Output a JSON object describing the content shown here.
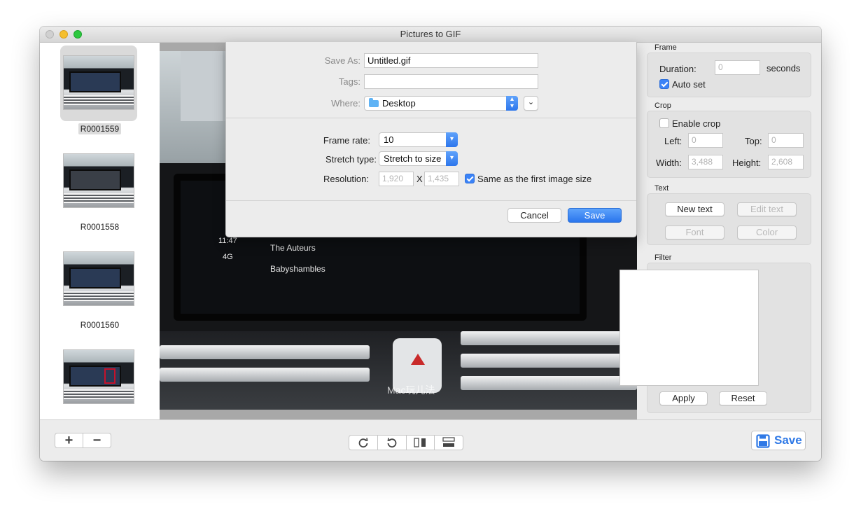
{
  "window": {
    "title": "Pictures to GIF"
  },
  "sidebar": {
    "items": [
      {
        "label": "R0001559",
        "selected": true
      },
      {
        "label": "R0001558",
        "selected": false
      },
      {
        "label": "R0001560",
        "selected": false
      },
      {
        "label": "",
        "selected": false
      }
    ]
  },
  "preview": {
    "songs": [
      "The Auteurs",
      "Babyshambles"
    ],
    "clock": "11:47",
    "network": "4G",
    "watermark": "Mac玩儿法"
  },
  "dialog": {
    "save_as_label": "Save As:",
    "save_as_value": "Untitled.gif",
    "tags_label": "Tags:",
    "tags_value": "",
    "where_label": "Where:",
    "where_value": "Desktop",
    "frame_rate_label": "Frame rate:",
    "frame_rate_value": "10",
    "stretch_label": "Stretch type:",
    "stretch_value": "Stretch to size",
    "resolution_label": "Resolution:",
    "res_width": "1,920",
    "res_x": "X",
    "res_height": "1,435",
    "same_size_label": "Same as the first image size",
    "same_size_checked": true,
    "cancel_label": "Cancel",
    "save_label": "Save"
  },
  "panel": {
    "frame": {
      "title": "Frame",
      "duration_label": "Duration:",
      "duration_value": "0",
      "seconds_label": "seconds",
      "auto_set_label": "Auto set",
      "auto_set_checked": true
    },
    "crop": {
      "title": "Crop",
      "enable_label": "Enable crop",
      "enable_checked": false,
      "left_label": "Left:",
      "left_value": "0",
      "top_label": "Top:",
      "top_value": "0",
      "width_label": "Width:",
      "width_value": "3,488",
      "height_label": "Height:",
      "height_value": "2,608"
    },
    "text": {
      "title": "Text",
      "new_text": "New text",
      "edit_text": "Edit text",
      "font": "Font",
      "color": "Color"
    },
    "filter": {
      "title": "Filter",
      "apply": "Apply",
      "reset": "Reset"
    }
  },
  "bottom": {
    "add_glyph": "+",
    "remove_glyph": "−",
    "save_label": "Save"
  },
  "colors": {
    "accent": "#2f79e6",
    "window_bg": "#ececec"
  },
  "icons": [
    "plus-icon",
    "minus-icon",
    "rotate-cw-icon",
    "rotate-ccw-icon",
    "flip-horizontal-icon",
    "flip-vertical-icon",
    "floppy-disk-icon",
    "folder-icon",
    "chevron-down-icon",
    "updown-arrows-icon"
  ]
}
